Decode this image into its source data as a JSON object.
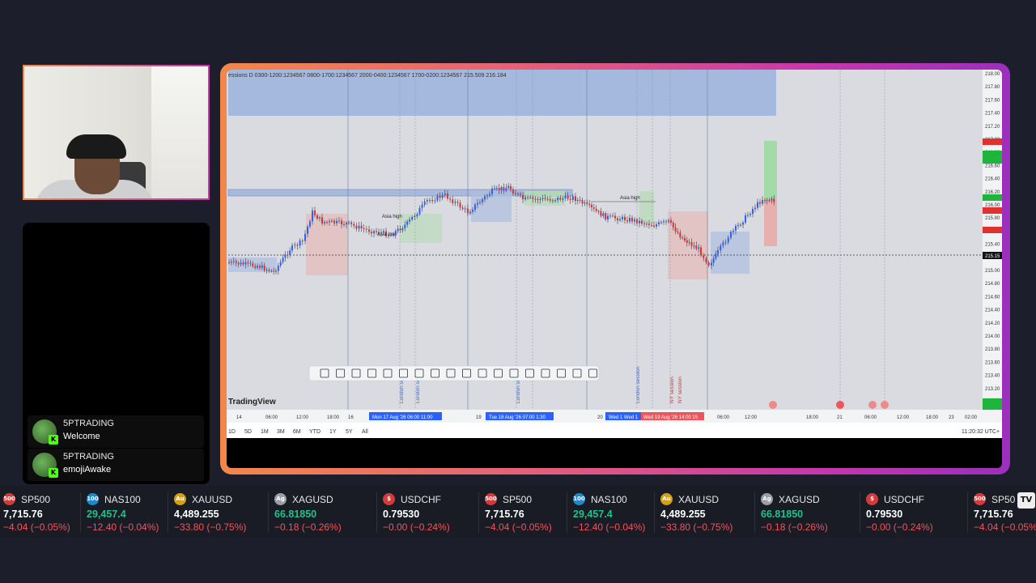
{
  "chat": {
    "messages": [
      {
        "user": "5PTRADING",
        "text": "Welcome"
      },
      {
        "user": "5PTRADING",
        "text": "emojiAwake"
      }
    ]
  },
  "chart": {
    "sessions_legend": "essions D  0300-1200:1234567  0800-1700:1234567  2000-0400:1234567  1700-0200:1234567  215.509  216.184",
    "brand": "TradingView",
    "timezone_label": "11:20:32 UTC+",
    "price_axis": [
      "218.00",
      "217.80",
      "217.60",
      "217.40",
      "217.20",
      "217.00",
      "216.80",
      "216.60",
      "216.40",
      "216.20",
      "216.00",
      "215.80",
      "215.60",
      "215.40",
      "215.20",
      "215.00",
      "214.80",
      "214.60",
      "214.40",
      "214.20",
      "214.00",
      "213.80",
      "213.60",
      "213.40",
      "213.20",
      "213.00"
    ],
    "time_axis": [
      "14",
      "06:00",
      "12:00",
      "18:00",
      "16",
      "18",
      "19",
      "20",
      "06:00",
      "12:00",
      "18:00",
      "21",
      "06:00",
      "12:00",
      "18:00",
      "23",
      "02:00"
    ],
    "time_highlights": [
      "Mon 17 Aug '26  06:00  11:00",
      "Tue 18 Aug '26  07:00  1:30",
      "Wed 1  Wed 1",
      "Wed 19 Aug '26  14:00  15"
    ],
    "annotations": [
      "Asia high",
      "Asia low",
      "Asia high",
      "London session",
      "London session",
      "London session",
      "London session",
      "NY session",
      "NY session"
    ],
    "current_price": "215.15",
    "timeframes": [
      "1D",
      "5D",
      "1M",
      "3M",
      "6M",
      "YTD",
      "1Y",
      "5Y",
      "All"
    ]
  },
  "ticker": {
    "items": [
      {
        "sym": "SP500",
        "icon": "500",
        "price": "7,715.76",
        "change": "−4.04 (−0.05%)",
        "price_color": "#ffffff",
        "icon_color": "#d23b3b"
      },
      {
        "sym": "NAS100",
        "icon": "100",
        "price": "29,457.4",
        "change": "−12.40 (−0.04%)",
        "price_color": "#22c08c",
        "icon_color": "#1e88c8"
      },
      {
        "sym": "XAUUSD",
        "icon": "Au",
        "price": "4,489.255",
        "change": "−33.80 (−0.75%)",
        "price_color": "#ffffff",
        "icon_color": "#d4a017"
      },
      {
        "sym": "XAGUSD",
        "icon": "Ag",
        "price": "66.81850",
        "change": "−0.18 (−0.26%)",
        "price_color": "#22c08c",
        "icon_color": "#9a9ea6"
      },
      {
        "sym": "USDCHF",
        "icon": "$",
        "price": "0.79530",
        "change": "−0.00 (−0.24%)",
        "price_color": "#ffffff",
        "icon_color": "#d23b3b"
      },
      {
        "sym": "SP500",
        "icon": "500",
        "price": "7,715.76",
        "change": "−4.04 (−0.05%)",
        "price_color": "#ffffff",
        "icon_color": "#d23b3b"
      },
      {
        "sym": "NAS100",
        "icon": "100",
        "price": "29,457.4",
        "change": "−12.40 (−0.04%)",
        "price_color": "#22c08c",
        "icon_color": "#1e88c8"
      },
      {
        "sym": "XAUUSD",
        "icon": "Au",
        "price": "4,489.255",
        "change": "−33.80 (−0.75%)",
        "price_color": "#ffffff",
        "icon_color": "#d4a017"
      },
      {
        "sym": "XAGUSD",
        "icon": "Ag",
        "price": "66.81850",
        "change": "−0.18 (−0.26%)",
        "price_color": "#22c08c",
        "icon_color": "#9a9ea6"
      },
      {
        "sym": "USDCHF",
        "icon": "$",
        "price": "0.79530",
        "change": "−0.00 (−0.24%)",
        "price_color": "#ffffff",
        "icon_color": "#d23b3b"
      },
      {
        "sym": "SP50",
        "icon": "500",
        "price": "7,715.76",
        "change": "−4.04 (−0.05%",
        "price_color": "#ffffff",
        "icon_color": "#d23b3b"
      }
    ],
    "logo": "TV"
  }
}
